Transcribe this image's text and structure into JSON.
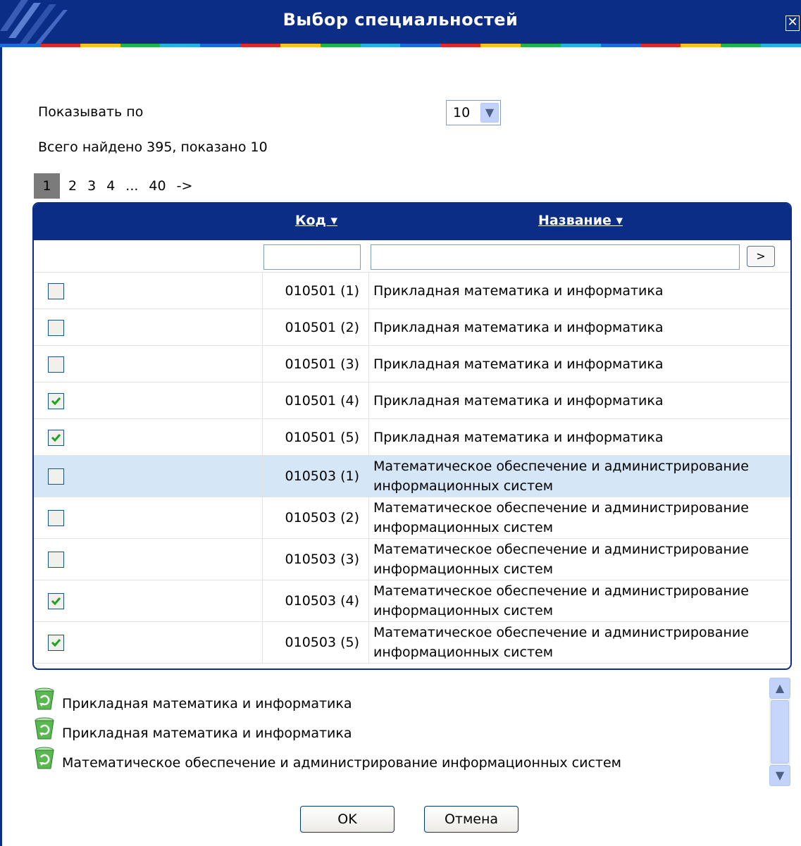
{
  "dialog": {
    "title": "Выбор специальностей",
    "close_label": "✕"
  },
  "page_size": {
    "label": "Показывать по",
    "value": "10"
  },
  "total_text": "Всего найдено 395, показано 10",
  "pager": {
    "current": "1",
    "pages": [
      "2",
      "3",
      "4",
      "...",
      "40",
      "->"
    ]
  },
  "table": {
    "col_kod": "Код ▾",
    "col_name": "Название ▾",
    "filter_go": ">",
    "rows": [
      {
        "kod": "010501 (1)",
        "name": "Прикладная математика и информатика",
        "checked": false
      },
      {
        "kod": "010501 (2)",
        "name": "Прикладная математика и информатика",
        "checked": false
      },
      {
        "kod": "010501 (3)",
        "name": "Прикладная математика и информатика",
        "checked": false
      },
      {
        "kod": "010501 (4)",
        "name": "Прикладная математика и информатика",
        "checked": true
      },
      {
        "kod": "010501 (5)",
        "name": "Прикладная математика и информатика",
        "checked": true
      },
      {
        "kod": "010503 (1)",
        "name": "Математическое обеспечение и администрирование информационных систем",
        "checked": false
      },
      {
        "kod": "010503 (2)",
        "name": "Математическое обеспечение и администрирование информационных систем",
        "checked": false
      },
      {
        "kod": "010503 (3)",
        "name": "Математическое обеспечение и администрирование информационных систем",
        "checked": false
      },
      {
        "kod": "010503 (4)",
        "name": "Математическое обеспечение и администрирование информационных систем",
        "checked": true
      },
      {
        "kod": "010503 (5)",
        "name": "Математическое обеспечение и администрирование информационных систем",
        "checked": true
      }
    ]
  },
  "selected_items": [
    {
      "icon": "recycle-bin-icon",
      "label": "Прикладная математика и информатика"
    },
    {
      "icon": "recycle-bin-icon",
      "label": "Прикладная математика и информатика"
    },
    {
      "icon": "recycle-bin-icon",
      "label": "Математическое обеспечение и администрирование информационных систем"
    }
  ],
  "buttons": {
    "ok": "OK",
    "cancel": "Отмена"
  },
  "colors": {
    "header_blue": "#0b2d86",
    "row_highlight": "#d5e7f7",
    "check_green": "#21a121"
  }
}
